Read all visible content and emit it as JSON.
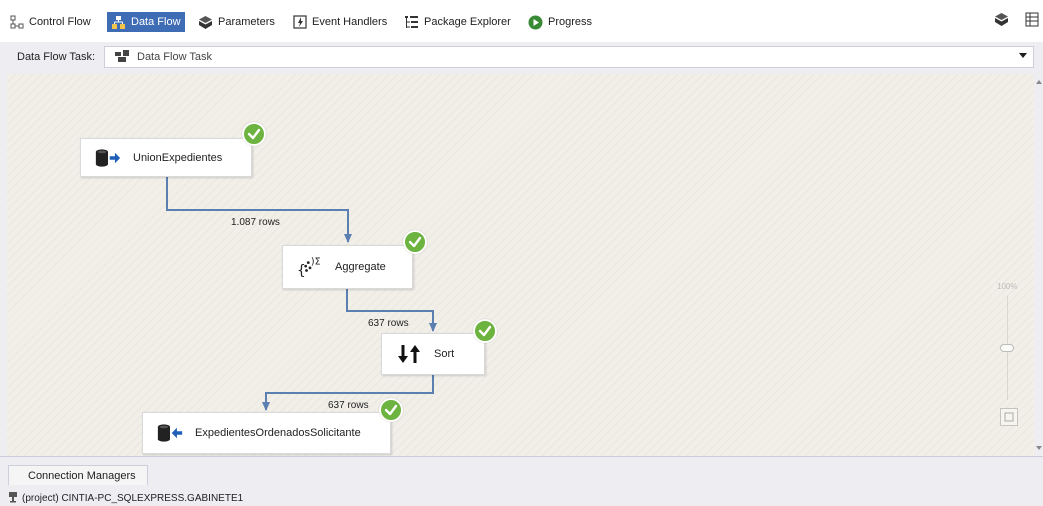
{
  "tabs": [
    {
      "label": "Control Flow",
      "icon": "control-flow-icon",
      "active": false
    },
    {
      "label": "Data Flow",
      "icon": "data-flow-icon",
      "active": true
    },
    {
      "label": "Parameters",
      "icon": "parameters-icon",
      "active": false
    },
    {
      "label": "Event Handlers",
      "icon": "event-handlers-icon",
      "active": false
    },
    {
      "label": "Package Explorer",
      "icon": "package-explorer-icon",
      "active": false
    },
    {
      "label": "Progress",
      "icon": "progress-icon",
      "active": false
    }
  ],
  "task": {
    "label": "Data Flow Task:",
    "selected": "Data Flow Task"
  },
  "nodes": {
    "source": "UnionExpedientes",
    "aggregate": "Aggregate",
    "sort": "Sort",
    "destination": "ExpedientesOrdenadosSolicitante"
  },
  "paths": {
    "p1": "1.087 rows",
    "p2": "637 rows",
    "p3": "637 rows"
  },
  "zoom": {
    "level": "100%"
  },
  "connection_managers": {
    "tab_label": "Connection Managers",
    "items": [
      "(project) CINTIA-PC_SQLEXPRESS.GABINETE1"
    ]
  },
  "colors": {
    "accent": "#3e6db5",
    "success": "#6cb33f",
    "path": "#5a7fb0"
  }
}
